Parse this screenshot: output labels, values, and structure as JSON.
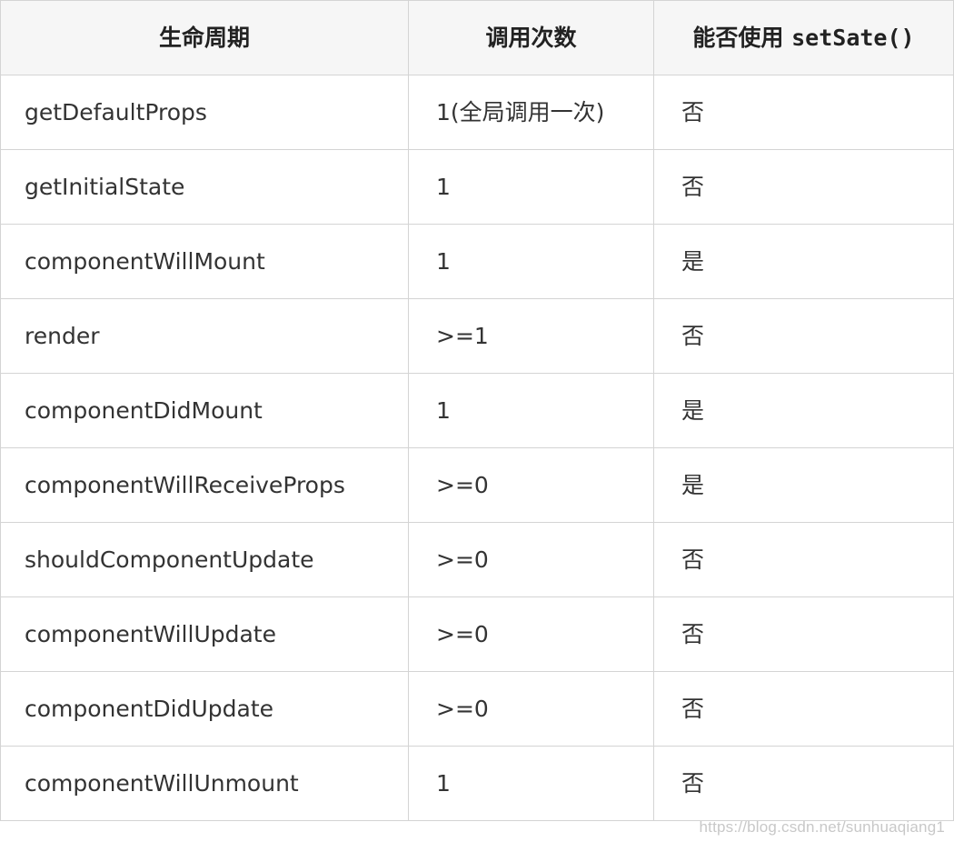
{
  "table": {
    "headers": {
      "lifecycle": "生命周期",
      "calls": "调用次数",
      "setstate_prefix": "能否使用 ",
      "setstate_code": "setSate()"
    },
    "rows": [
      {
        "method": "getDefaultProps",
        "calls": "1(全局调用一次)",
        "can_setstate": "否"
      },
      {
        "method": "getInitialState",
        "calls": "1",
        "can_setstate": "否"
      },
      {
        "method": "componentWillMount",
        "calls": "1",
        "can_setstate": "是"
      },
      {
        "method": "render",
        "calls": ">=1",
        "can_setstate": "否"
      },
      {
        "method": "componentDidMount",
        "calls": "1",
        "can_setstate": "是"
      },
      {
        "method": "componentWillReceiveProps",
        "calls": ">=0",
        "can_setstate": "是"
      },
      {
        "method": "shouldComponentUpdate",
        "calls": ">=0",
        "can_setstate": "否"
      },
      {
        "method": "componentWillUpdate",
        "calls": ">=0",
        "can_setstate": "否"
      },
      {
        "method": "componentDidUpdate",
        "calls": ">=0",
        "can_setstate": "否"
      },
      {
        "method": "componentWillUnmount",
        "calls": "1",
        "can_setstate": "否"
      }
    ]
  },
  "watermark": "https://blog.csdn.net/sunhuaqiang1"
}
